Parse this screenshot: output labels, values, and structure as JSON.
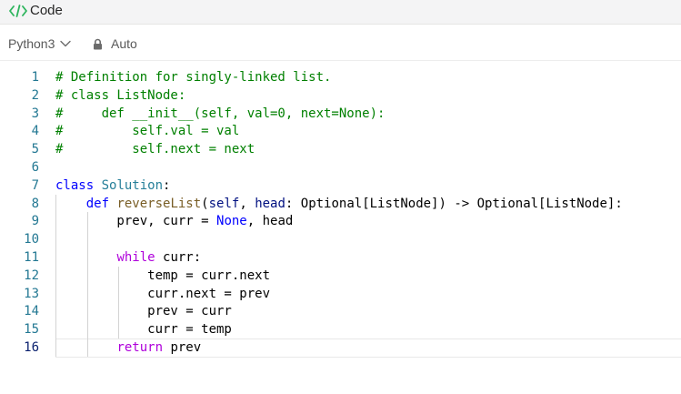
{
  "header": {
    "title": "Code",
    "icon": "code-brackets-icon",
    "accent": "#2db55d"
  },
  "toolbar": {
    "language": "Python3",
    "mode": "Auto",
    "language_icon": "chevron-down-icon",
    "mode_icon": "lock-icon"
  },
  "editor": {
    "active_line": 16,
    "lines": [
      {
        "n": "1",
        "tokens": [
          {
            "t": "# Definition for singly-linked list.",
            "k": "comment"
          }
        ]
      },
      {
        "n": "2",
        "tokens": [
          {
            "t": "# class ListNode:",
            "k": "comment"
          }
        ]
      },
      {
        "n": "3",
        "tokens": [
          {
            "t": "#     def __init__(self, val=0, next=None):",
            "k": "comment"
          }
        ]
      },
      {
        "n": "4",
        "tokens": [
          {
            "t": "#         self.val = val",
            "k": "comment"
          }
        ]
      },
      {
        "n": "5",
        "tokens": [
          {
            "t": "#         self.next = next",
            "k": "comment"
          }
        ]
      },
      {
        "n": "6",
        "tokens": []
      },
      {
        "n": "7",
        "tokens": [
          {
            "t": "class",
            "k": "keyword"
          },
          {
            "t": " ",
            "k": "plain"
          },
          {
            "t": "Solution",
            "k": "class"
          },
          {
            "t": ":",
            "k": "plain"
          }
        ]
      },
      {
        "n": "8",
        "tokens": [
          {
            "t": "    ",
            "k": "plain"
          },
          {
            "t": "def",
            "k": "keyword"
          },
          {
            "t": " ",
            "k": "plain"
          },
          {
            "t": "reverseList",
            "k": "func"
          },
          {
            "t": "(",
            "k": "plain"
          },
          {
            "t": "self",
            "k": "param"
          },
          {
            "t": ", ",
            "k": "plain"
          },
          {
            "t": "head",
            "k": "param"
          },
          {
            "t": ": Optional[ListNode]) -> Optional[ListNode]:",
            "k": "plain"
          }
        ]
      },
      {
        "n": "9",
        "tokens": [
          {
            "t": "        prev, curr = ",
            "k": "plain"
          },
          {
            "t": "None",
            "k": "keyword"
          },
          {
            "t": ", head",
            "k": "plain"
          }
        ]
      },
      {
        "n": "10",
        "tokens": []
      },
      {
        "n": "11",
        "tokens": [
          {
            "t": "        ",
            "k": "plain"
          },
          {
            "t": "while",
            "k": "control"
          },
          {
            "t": " curr:",
            "k": "plain"
          }
        ]
      },
      {
        "n": "12",
        "tokens": [
          {
            "t": "            temp = curr.next",
            "k": "plain"
          }
        ]
      },
      {
        "n": "13",
        "tokens": [
          {
            "t": "            curr.next = prev",
            "k": "plain"
          }
        ]
      },
      {
        "n": "14",
        "tokens": [
          {
            "t": "            prev = curr",
            "k": "plain"
          }
        ]
      },
      {
        "n": "15",
        "tokens": [
          {
            "t": "            curr = temp",
            "k": "plain"
          }
        ]
      },
      {
        "n": "16",
        "tokens": [
          {
            "t": "        ",
            "k": "plain"
          },
          {
            "t": "return",
            "k": "control"
          },
          {
            "t": " prev",
            "k": "plain"
          }
        ]
      }
    ]
  }
}
